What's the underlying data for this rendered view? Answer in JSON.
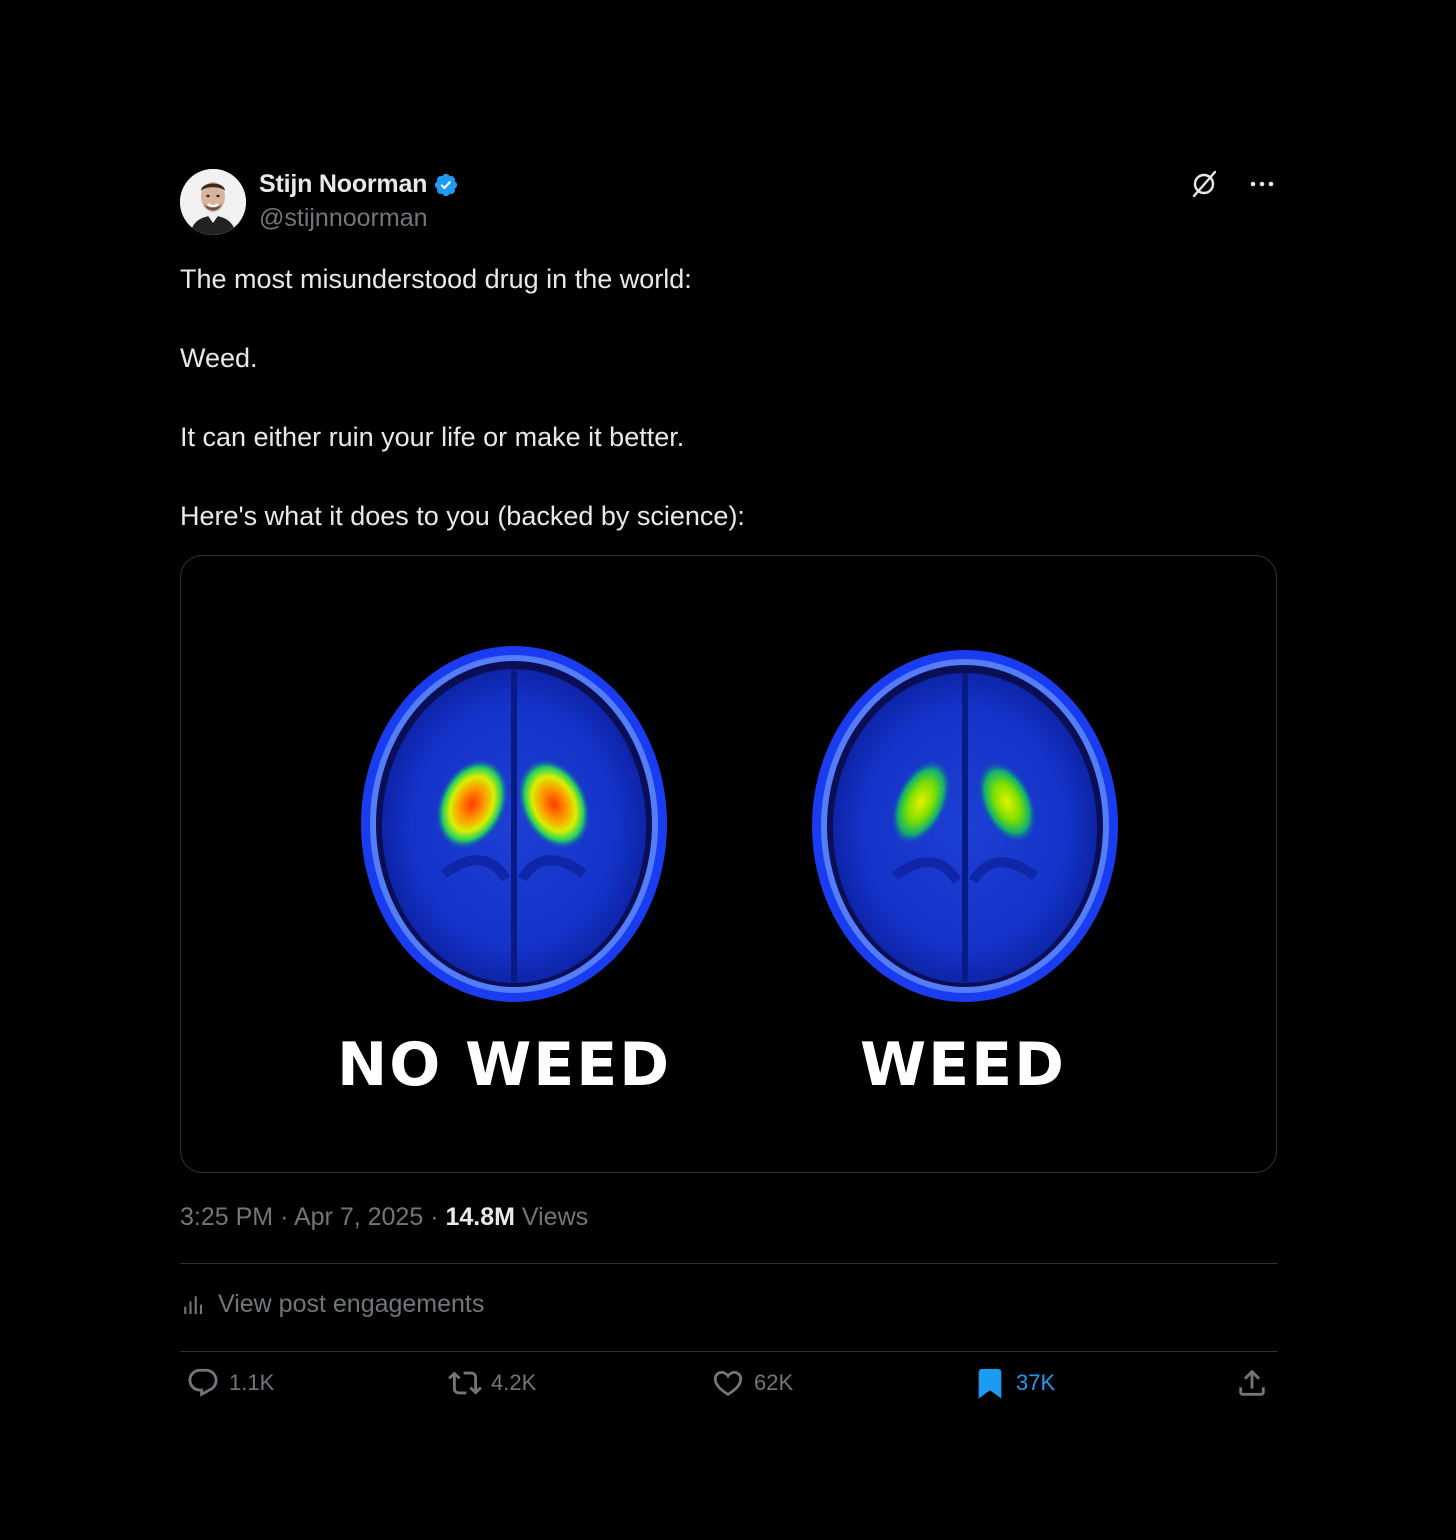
{
  "author": {
    "name": "Stijn Noorman",
    "handle": "@stijnnoorman",
    "verified_color": "#1d9bf0"
  },
  "post": {
    "paragraphs": [
      "The most misunderstood drug in the world:",
      "Weed.",
      "It can either ruin your life or make it better.",
      "Here's what it does to you (backed by science):"
    ],
    "image": {
      "left_label": "NO WEED",
      "right_label": "WEED"
    },
    "time": "3:25 PM",
    "date": "Apr 7, 2025",
    "views_count": "14.8M",
    "views_label": "Views"
  },
  "engagements_link": "View post engagements",
  "actions": {
    "replies": "1.1K",
    "reposts": "4.2K",
    "likes": "62K",
    "bookmarks": "37K"
  },
  "icons": [
    "grok-icon",
    "more-icon",
    "verified-badge-icon",
    "chart-icon",
    "reply-icon",
    "repost-icon",
    "like-icon",
    "bookmark-icon",
    "share-icon"
  ],
  "colors": {
    "background": "#000000",
    "text": "#e7e9ea",
    "muted": "#71767b",
    "accent": "#1d9bf0",
    "border": "#2f3336"
  }
}
